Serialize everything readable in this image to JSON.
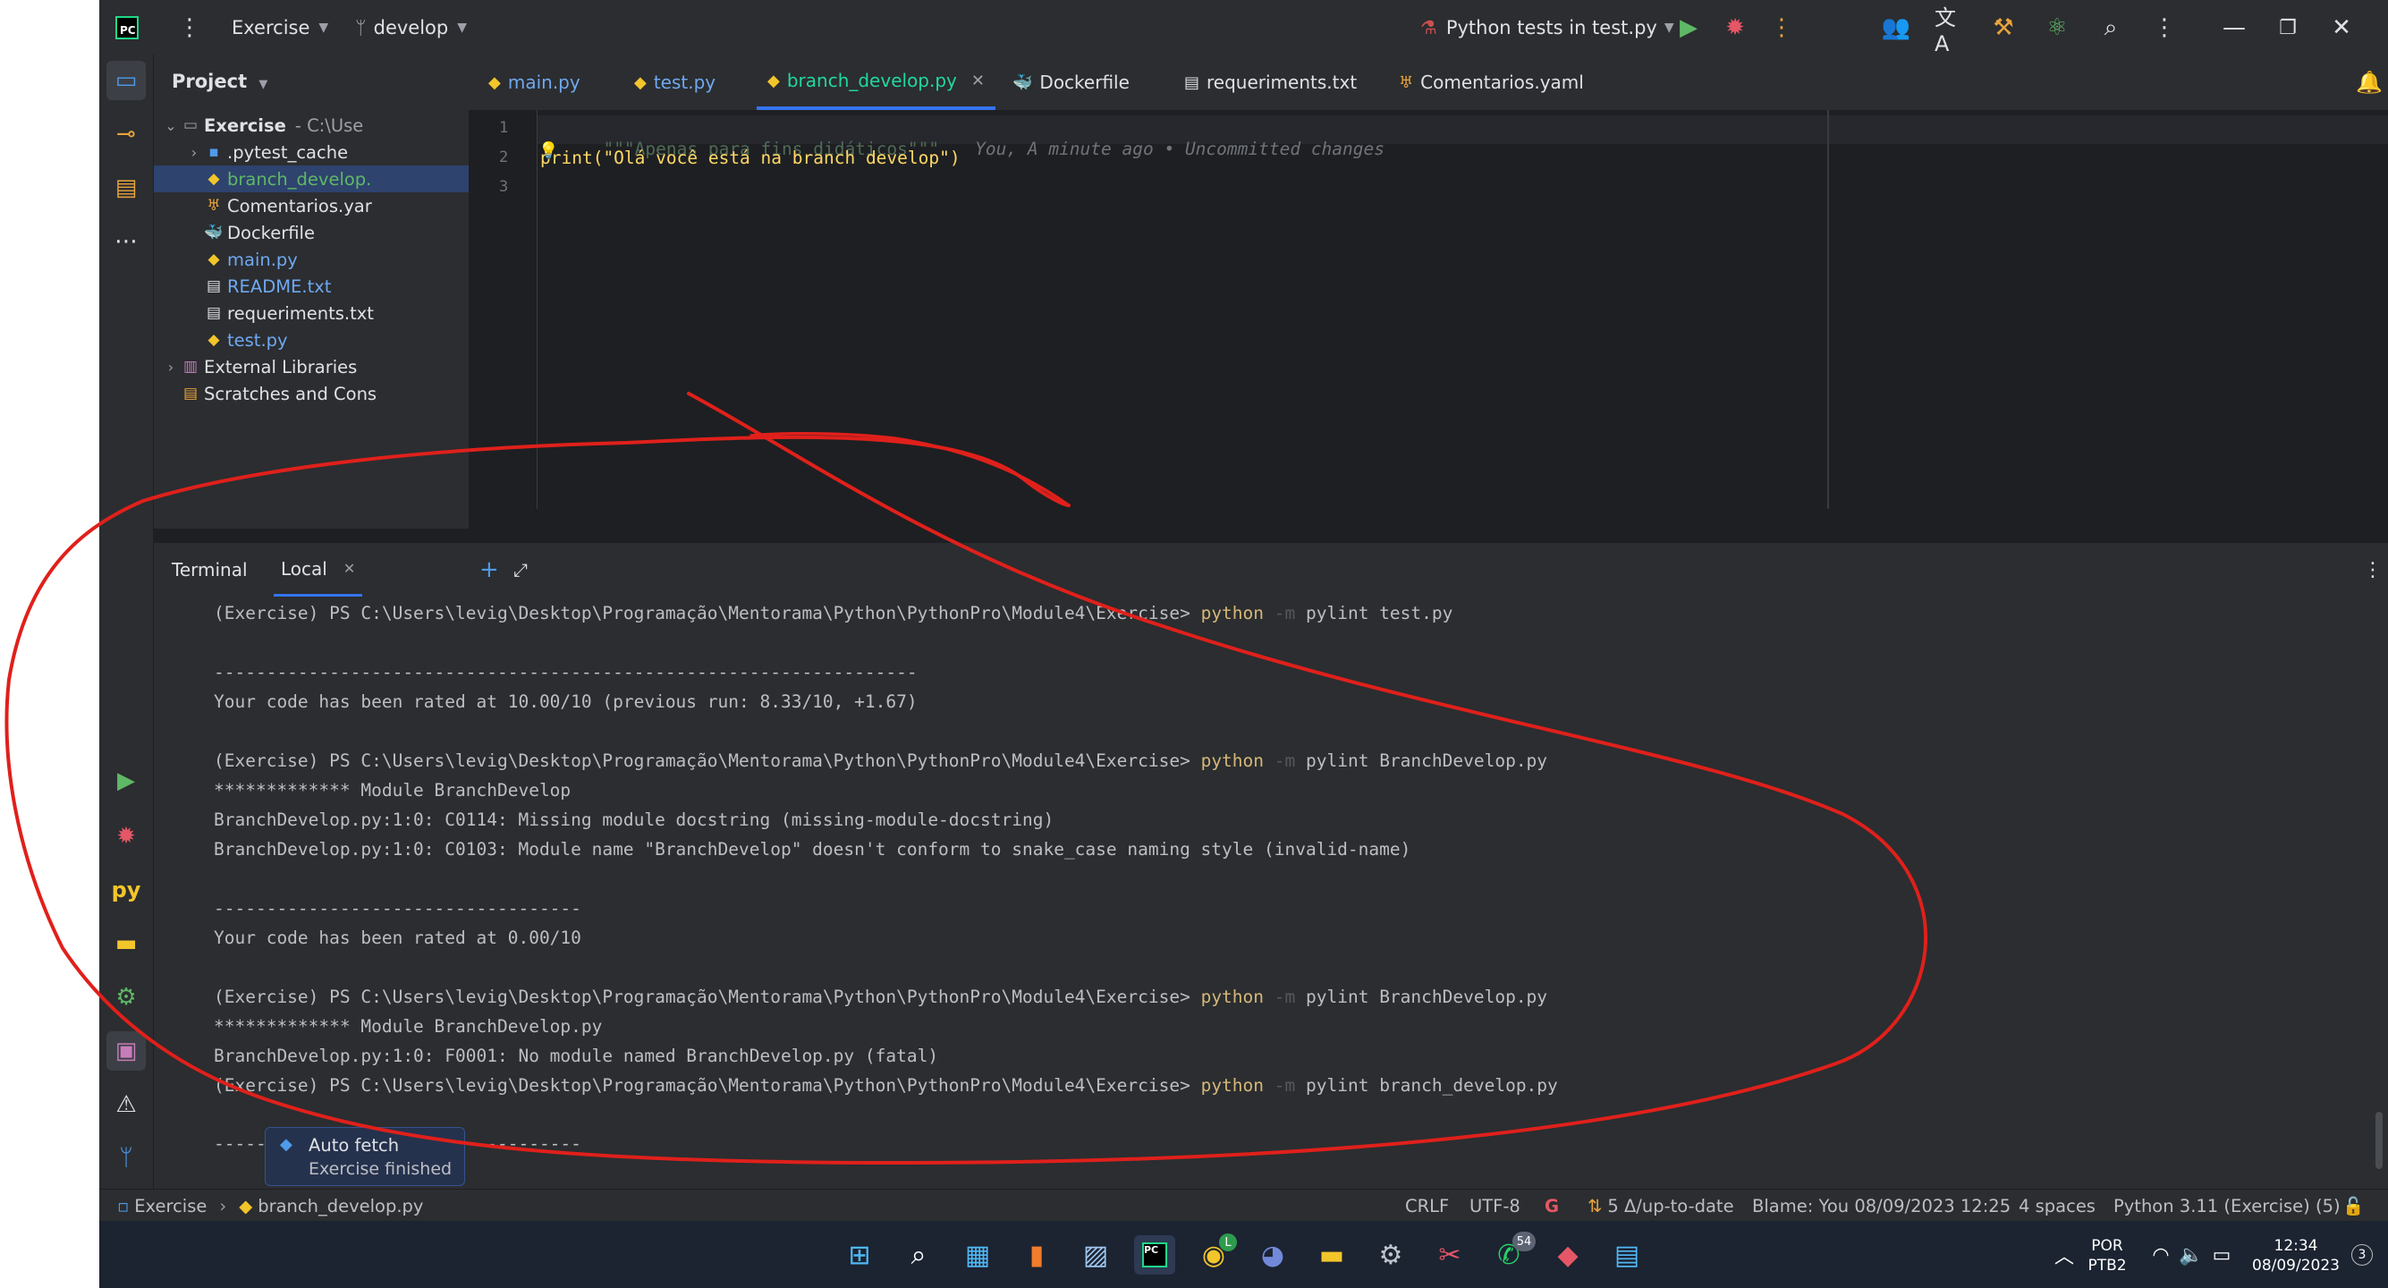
{
  "titlebar": {
    "project": "Exercise",
    "branch": "develop",
    "run_config": "Python tests in test.py"
  },
  "project_panel": {
    "title": "Project",
    "items": [
      {
        "label": "Exercise",
        "suffix": "- C:\\Use",
        "type": "folder"
      },
      {
        "label": ".pytest_cache",
        "type": "folder"
      },
      {
        "label": "branch_develop.",
        "type": "py"
      },
      {
        "label": "Comentarios.yar",
        "type": "yaml"
      },
      {
        "label": "Dockerfile",
        "type": "docker"
      },
      {
        "label": "main.py",
        "type": "py"
      },
      {
        "label": "README.txt",
        "type": "txt"
      },
      {
        "label": "requeriments.txt",
        "type": "txt"
      },
      {
        "label": "test.py",
        "type": "py"
      },
      {
        "label": "External Libraries",
        "type": "lib"
      },
      {
        "label": "Scratches and Cons",
        "type": "scratch"
      }
    ]
  },
  "editor": {
    "tabs": [
      {
        "label": "main.py"
      },
      {
        "label": "test.py"
      },
      {
        "label": "branch_develop.py"
      },
      {
        "label": "Dockerfile"
      },
      {
        "label": "requeriments.txt"
      },
      {
        "label": "Comentarios.yaml"
      }
    ],
    "lines": [
      {
        "num": "1",
        "text": "\"\"\"Apenas para fins didáticos\"\"\"",
        "blame": "You, A minute ago • Uncommitted changes"
      },
      {
        "num": "2",
        "text": "print(\"Olá você está na branch develop\")"
      },
      {
        "num": "3",
        "text": ""
      }
    ]
  },
  "terminal": {
    "title": "Terminal",
    "tab": "Local",
    "prompt": "(Exercise) PS C:\\Users\\levig\\Desktop\\Programação\\Mentorama\\Python\\PythonPro\\Module4\\Exercise>",
    "cmd_python": "python",
    "cmd_flag": "-m",
    "lines": {
      "cmd1": "pylint test.py",
      "sep1": "-------------------------------------------------------------------",
      "rated1": "Your code has been rated at 10.00/10 (previous run: 8.33/10, +1.67)",
      "cmd2": "pylint BranchDevelop.py",
      "module1": "************* Module BranchDevelop",
      "err1": "BranchDevelop.py:1:0: C0114: Missing module docstring (missing-module-docstring)",
      "err2": "BranchDevelop.py:1:0: C0103: Module name \"BranchDevelop\" doesn't conform to snake_case naming style (invalid-name)",
      "sep2": "-----------------------------------",
      "rated2": "Your code has been rated at 0.00/10",
      "cmd3": "pylint BranchDevelop.py",
      "module2": "************* Module BranchDevelop.py",
      "err3": "BranchDevelop.py:1:0: F0001: No module named BranchDevelop.py (fatal)",
      "cmd4": "pylint branch_develop.py",
      "sep3": "-----------------------------------"
    }
  },
  "notification": {
    "title": "Auto fetch",
    "body": "Exercise finished"
  },
  "statusbar": {
    "breadcrumb_root": "Exercise",
    "breadcrumb_file": "branch_develop.py",
    "line_sep": "CRLF",
    "encoding": "UTF-8",
    "vcs": "5 Δ/up-to-date",
    "blame": "Blame: You 08/09/2023 12:25",
    "indent": "4 spaces",
    "interpreter": "Python 3.11 (Exercise) (5)"
  },
  "taskbar": {
    "lang": "POR",
    "layout": "PTB2",
    "time": "12:34",
    "date": "08/09/2023",
    "whatsapp_badge": "54",
    "chrome_badge": "L",
    "notif_count": "3"
  },
  "colors": {
    "annotation_red": "#e0201b",
    "accent_blue": "#3574f0",
    "active_tab_green": "#21d7a0"
  }
}
